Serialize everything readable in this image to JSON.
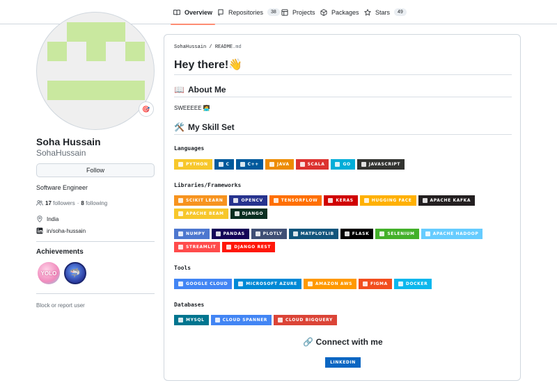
{
  "nav": {
    "tabs": [
      {
        "label": "Overview",
        "icon": "book-icon",
        "active": true
      },
      {
        "label": "Repositories",
        "icon": "repo-icon",
        "count": "38"
      },
      {
        "label": "Projects",
        "icon": "table-icon"
      },
      {
        "label": "Packages",
        "icon": "package-icon"
      },
      {
        "label": "Stars",
        "icon": "star-icon",
        "count": "49"
      }
    ]
  },
  "profile": {
    "status_emoji": "🎯",
    "name": "Soha Hussain",
    "login": "SohaHussain",
    "follow_label": "Follow",
    "bio": "Software Engineer",
    "followers_count": "17",
    "followers_label": "followers",
    "dot": "·",
    "following_count": "8",
    "following_label": "following",
    "location": "India",
    "linkedin": "in/soha-hussain",
    "achievements_title": "Achievements",
    "achievements": [
      {
        "name": "YOLO",
        "label": "YOLO",
        "color": "#f5a5c8"
      },
      {
        "name": "Pull Shark",
        "label": "🦈",
        "color": "#3b4bb3"
      }
    ],
    "block_label": "Block or report user"
  },
  "readme": {
    "crumb_user": "SohaHussain",
    "crumb_sep": "/",
    "crumb_file": "README",
    "crumb_ext": ".md",
    "title": "Hey there!👋",
    "about_emoji": "📖",
    "about_title": "About Me",
    "about_text": "SWEEEEE 🧑‍💻",
    "skills_emoji": "🛠️",
    "skills_title": "My Skill Set",
    "languages_title": "Languages",
    "languages": [
      {
        "label": "Python",
        "color": "#f7c72b"
      },
      {
        "label": "C",
        "color": "#00599c"
      },
      {
        "label": "C++",
        "color": "#00599c"
      },
      {
        "label": "Java",
        "color": "#ed8b00"
      },
      {
        "label": "Scala",
        "color": "#dc322f"
      },
      {
        "label": "Go",
        "color": "#00add8"
      },
      {
        "label": "JavaScript",
        "color": "#323330"
      }
    ],
    "libraries_title": "Libraries/Frameworks",
    "libraries_row1": [
      {
        "label": "scikit learn",
        "color": "#f7931e"
      },
      {
        "label": "OpenCV",
        "color": "#27338e"
      },
      {
        "label": "TensorFlow",
        "color": "#ff6f00"
      },
      {
        "label": "Keras",
        "color": "#d00000"
      },
      {
        "label": "Hugging Face",
        "color": "#ffb000"
      },
      {
        "label": "Apache Kafka",
        "color": "#231f20"
      }
    ],
    "libraries_row2": [
      {
        "label": "Apache Beam",
        "color": "#f7c72b"
      },
      {
        "label": "Django",
        "color": "#092e20"
      }
    ],
    "libraries_row3": [
      {
        "label": "NumPy",
        "color": "#4d77cf"
      },
      {
        "label": "Pandas",
        "color": "#150458"
      },
      {
        "label": "Plotly",
        "color": "#3f4f75"
      },
      {
        "label": "Matplotlib",
        "color": "#11557c"
      },
      {
        "label": "Flask",
        "color": "#000000"
      },
      {
        "label": "Selenium",
        "color": "#43b02a"
      },
      {
        "label": "Apache Hadoop",
        "color": "#66ccff"
      }
    ],
    "libraries_row4": [
      {
        "label": "Streamlit",
        "color": "#ff4b4b"
      },
      {
        "label": "Django Rest",
        "color": "#ff1709"
      }
    ],
    "tools_title": "Tools",
    "tools": [
      {
        "label": "Google Cloud",
        "color": "#4285f4"
      },
      {
        "label": "Microsoft Azure",
        "color": "#0089d6"
      },
      {
        "label": "Amazon AWS",
        "color": "#ff9900"
      },
      {
        "label": "Figma",
        "color": "#f24e1e"
      },
      {
        "label": "Docker",
        "color": "#0db7ed"
      }
    ],
    "databases_title": "Databases",
    "databases": [
      {
        "label": "MySQL",
        "color": "#00758f"
      },
      {
        "label": "Cloud Spanner",
        "color": "#4285f4"
      },
      {
        "label": "Cloud BigQuery",
        "color": "#db4437"
      }
    ],
    "connect_emoji": "🔗",
    "connect_title": "Connect with me",
    "linkedin_badge": {
      "label": "LinkedIn",
      "color": "#0a66c2"
    }
  }
}
